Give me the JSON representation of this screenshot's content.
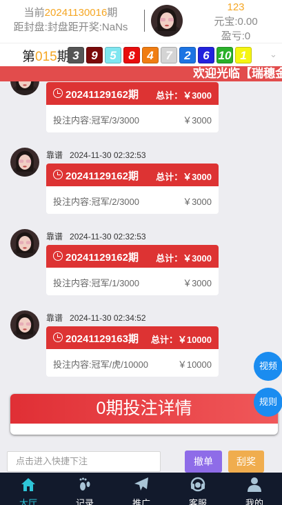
{
  "header": {
    "current_prefix": "当前",
    "current_issue": "20241130016",
    "current_suffix": "期",
    "countdown": "距封盘:封盘距开奖:NaNs",
    "user_id": "123",
    "balance": "元宝:0.00",
    "profit": "盈亏:0"
  },
  "draw": {
    "prefix": "第",
    "issue": "015",
    "suffix": "期",
    "balls": [
      {
        "n": "3",
        "color": "#555555"
      },
      {
        "n": "9",
        "color": "#7a0a0a"
      },
      {
        "n": "5",
        "color": "#7fe6f0"
      },
      {
        "n": "8",
        "color": "#e80d0d"
      },
      {
        "n": "4",
        "color": "#f07d12"
      },
      {
        "n": "7",
        "color": "#d4d4d4"
      },
      {
        "n": "2",
        "color": "#1c74e3"
      },
      {
        "n": "6",
        "color": "#2222dd"
      },
      {
        "n": "10",
        "color": "#2ab02a"
      },
      {
        "n": "1",
        "color": "#f5f512"
      }
    ]
  },
  "marquee": "欢迎光临【瑞穗金",
  "messages": [
    {
      "name": "",
      "time": "",
      "issue": "20241129162期",
      "total": "总计：￥3000",
      "content": "投注内容:冠军/3/3000",
      "amount": "￥3000"
    },
    {
      "name": "靠谱",
      "time": "2024-11-30 02:32:53",
      "issue": "20241129162期",
      "total": "总计：￥3000",
      "content": "投注内容:冠军/2/3000",
      "amount": "￥3000"
    },
    {
      "name": "靠谱",
      "time": "2024-11-30 02:32:53",
      "issue": "20241129162期",
      "total": "总计：￥3000",
      "content": "投注内容:冠军/1/3000",
      "amount": "￥3000"
    },
    {
      "name": "靠谱",
      "time": "2024-11-30 02:34:52",
      "issue": "20241129163期",
      "total": "总计：￥10000",
      "content": "投注内容:冠军/虎/10000",
      "amount": "￥10000"
    }
  ],
  "summary": "0期投注详情",
  "float_buttons": {
    "video": "视频",
    "rules": "规则"
  },
  "input": {
    "placeholder": "点击进入快捷下注",
    "cancel": "撤单",
    "scratch": "刮奖"
  },
  "tabs": [
    {
      "label": "大厅",
      "icon": "home-icon",
      "active": true
    },
    {
      "label": "记录",
      "icon": "footprint-icon",
      "active": false
    },
    {
      "label": "推广",
      "icon": "paper-plane-icon",
      "active": false
    },
    {
      "label": "客服",
      "icon": "headset-icon",
      "active": false
    },
    {
      "label": "我的",
      "icon": "user-icon",
      "active": false
    }
  ],
  "colors": {
    "accent": "#dd3333",
    "active_tab": "#2ec5d8",
    "highlight": "#f5a623"
  }
}
